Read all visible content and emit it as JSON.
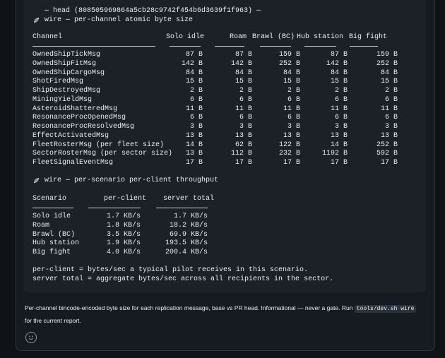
{
  "head_line": "— head (808505969864a5cb28c9742f454b6d3639f1f963) —",
  "wire1_title": "wire — per-channel atomic byte size",
  "channel_table": {
    "headers": [
      "Channel",
      "Solo idle",
      "Roam",
      "Brawl (BC)",
      "Hub station",
      "Big fight"
    ],
    "rows": [
      [
        "OwnedShipTickMsg",
        "87 B",
        "87 B",
        "159 B",
        "87 B",
        "159 B"
      ],
      [
        "OwnedShipFitMsg",
        "142 B",
        "142 B",
        "252 B",
        "142 B",
        "252 B"
      ],
      [
        "OwnedShipCargoMsg",
        "84 B",
        "84 B",
        "84 B",
        "84 B",
        "84 B"
      ],
      [
        "ShotFiredMsg",
        "15 B",
        "15 B",
        "15 B",
        "15 B",
        "15 B"
      ],
      [
        "ShipDestroyedMsg",
        "2 B",
        "2 B",
        "2 B",
        "2 B",
        "2 B"
      ],
      [
        "MiningYieldMsg",
        "6 B",
        "6 B",
        "6 B",
        "6 B",
        "6 B"
      ],
      [
        "AsteroidShatteredMsg",
        "11 B",
        "11 B",
        "11 B",
        "11 B",
        "11 B"
      ],
      [
        "ResonanceProcOpenedMsg",
        "6 B",
        "6 B",
        "6 B",
        "6 B",
        "6 B"
      ],
      [
        "ResonanceProcResolvedMsg",
        "3 B",
        "3 B",
        "3 B",
        "3 B",
        "3 B"
      ],
      [
        "EffectActivatedMsg",
        "13 B",
        "13 B",
        "13 B",
        "13 B",
        "13 B"
      ],
      [
        "FleetRosterMsg (per fleet size)",
        "14 B",
        "62 B",
        "122 B",
        "14 B",
        "252 B"
      ],
      [
        "SectorRosterMsg (per sector size)",
        "13 B",
        "112 B",
        "232 B",
        "1192 B",
        "592 B"
      ],
      [
        "FleetSignalEventMsg",
        "17 B",
        "17 B",
        "17 B",
        "17 B",
        "17 B"
      ]
    ]
  },
  "wire2_title": "wire — per-scenario per-client throughput",
  "scenario_table": {
    "headers": [
      "Scenario",
      "per-client",
      "server total"
    ],
    "rows": [
      [
        "Solo idle",
        "1.7 KB/s",
        "1.7 KB/s"
      ],
      [
        "Roam",
        "1.8 KB/s",
        "18.2 KB/s"
      ],
      [
        "Brawl (BC)",
        "3.5 KB/s",
        "69.9 KB/s"
      ],
      [
        "Hub station",
        "1.9 KB/s",
        "193.5 KB/s"
      ],
      [
        "Big fight",
        "4.0 KB/s",
        "200.4 KB/s"
      ]
    ]
  },
  "notes": [
    "per-client = bytes/sec a typical pilot receives in this scenario.",
    "server total = aggregate bytes/sec across all recipients in the sector."
  ],
  "description": {
    "before": "Per-channel bincode-encoded byte size for each replication message, base vs PR head. Informational — never a gate. Run ",
    "code": "tools/dev.sh wire",
    "after": " for the current report."
  },
  "icons": {
    "wire": "satellite-icon",
    "reaction": "smiley-icon"
  }
}
